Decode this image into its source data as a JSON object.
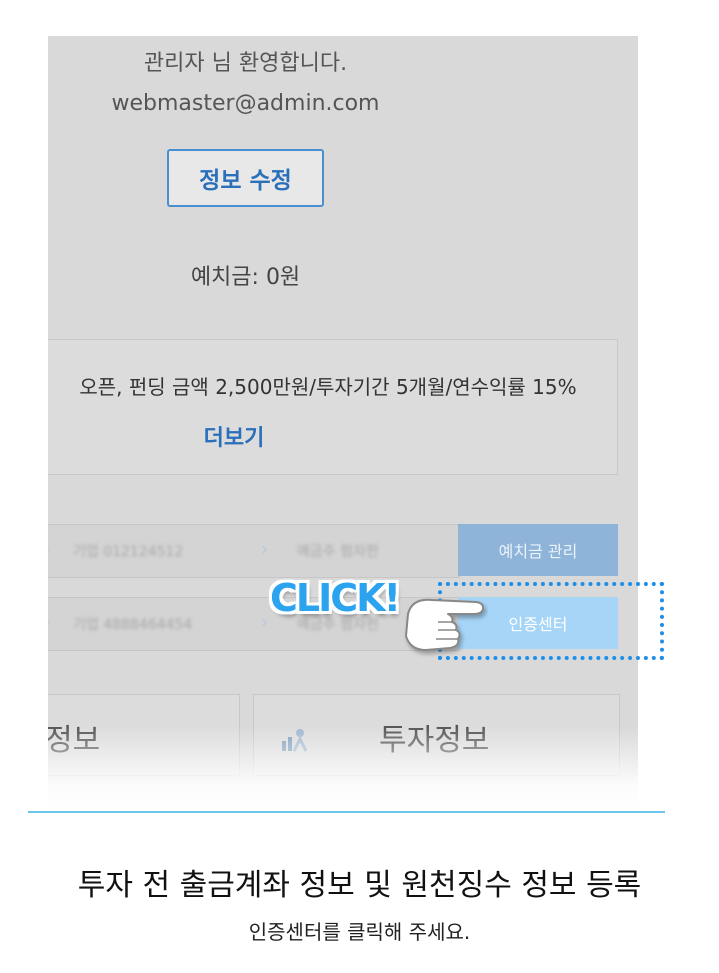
{
  "profile": {
    "greeting": "관리자 님 환영합니다.",
    "email": "webmaster@admin.com",
    "edit_button": "정보 수정",
    "deposit_label": "예치금: 0원"
  },
  "notice": {
    "text": "오픈, 펀딩 금액 2,500만원/투자기간 5개월/연수익률 15%",
    "more_link": "더보기"
  },
  "accounts": {
    "row1": {
      "account": "기업 012124512",
      "holder": "예금주 펌자펀",
      "button": "예치금 관리"
    },
    "row2": {
      "account": "기업 4888464454",
      "holder": "예금주 펌자펀",
      "button": "인증센터"
    }
  },
  "cards": {
    "left_title": "정보",
    "right_title": "투자정보",
    "right_icon": "chart-person-icon"
  },
  "overlay": {
    "click_text": "CLICK!",
    "hand_icon": "pointing-hand-icon",
    "highlight_color": "#1f8ee6"
  },
  "footer": {
    "title": "투자 전 출금계좌 정보 및 원천징수 정보 등록",
    "subtitle": "인증센터를 클릭해 주세요."
  },
  "colors": {
    "accent": "#2a6fba",
    "button_deposit": "#8fb4d9",
    "button_cert": "#a7d5f7",
    "divider": "#6cc6ea"
  }
}
